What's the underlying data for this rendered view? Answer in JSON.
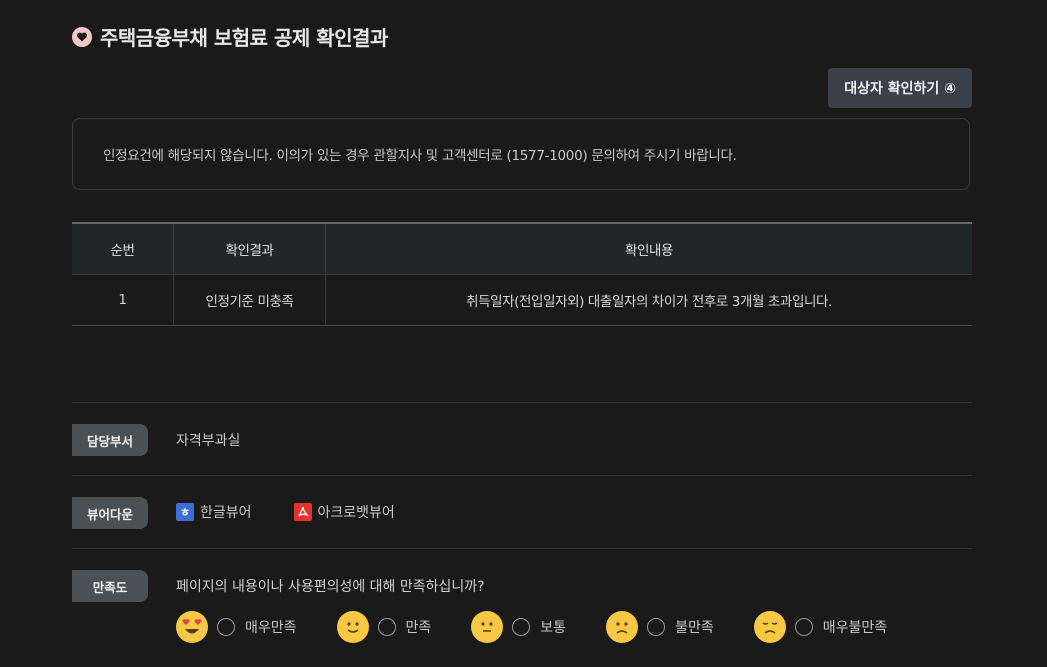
{
  "header": {
    "title": "주택금융부채 보험료 공제 확인결과",
    "icon": "heart-icon"
  },
  "check_button": {
    "label": "대상자 확인하기 ④"
  },
  "notice": {
    "text": "인정요건에 해당되지 않습니다. 이의가 있는 경우 관할지사 및 고객센터로 (1577-1000) 문의하여 주시기 바랍니다."
  },
  "table": {
    "headers": [
      "순번",
      "확인결과",
      "확인내용"
    ],
    "rows": [
      [
        "1",
        "인정기준 미충족",
        "취득일자(전입일자외) 대출일자의 차이가 전후로 3개월 초과입니다."
      ]
    ]
  },
  "department": {
    "tag": "담당부서",
    "value": "자격부과실"
  },
  "viewer_download": {
    "tag": "뷰어다운",
    "items": [
      {
        "label": "한글뷰어",
        "icon": "hwp-icon",
        "color": "#3d6fd1"
      },
      {
        "label": "아크로뱃뷰어",
        "icon": "pdf-icon",
        "color": "#e5322d"
      }
    ]
  },
  "satisfaction": {
    "tag": "만족도",
    "question": "페이지의 내용이나 사용편의성에 대해 만족하십니까?",
    "options": [
      {
        "label": "매우만족",
        "icon": "heart-eyes-face-icon"
      },
      {
        "label": "만족",
        "icon": "smile-face-icon"
      },
      {
        "label": "보통",
        "icon": "neutral-face-icon"
      },
      {
        "label": "불만족",
        "icon": "frown-face-icon"
      },
      {
        "label": "매우불만족",
        "icon": "unhappy-face-icon"
      }
    ]
  }
}
